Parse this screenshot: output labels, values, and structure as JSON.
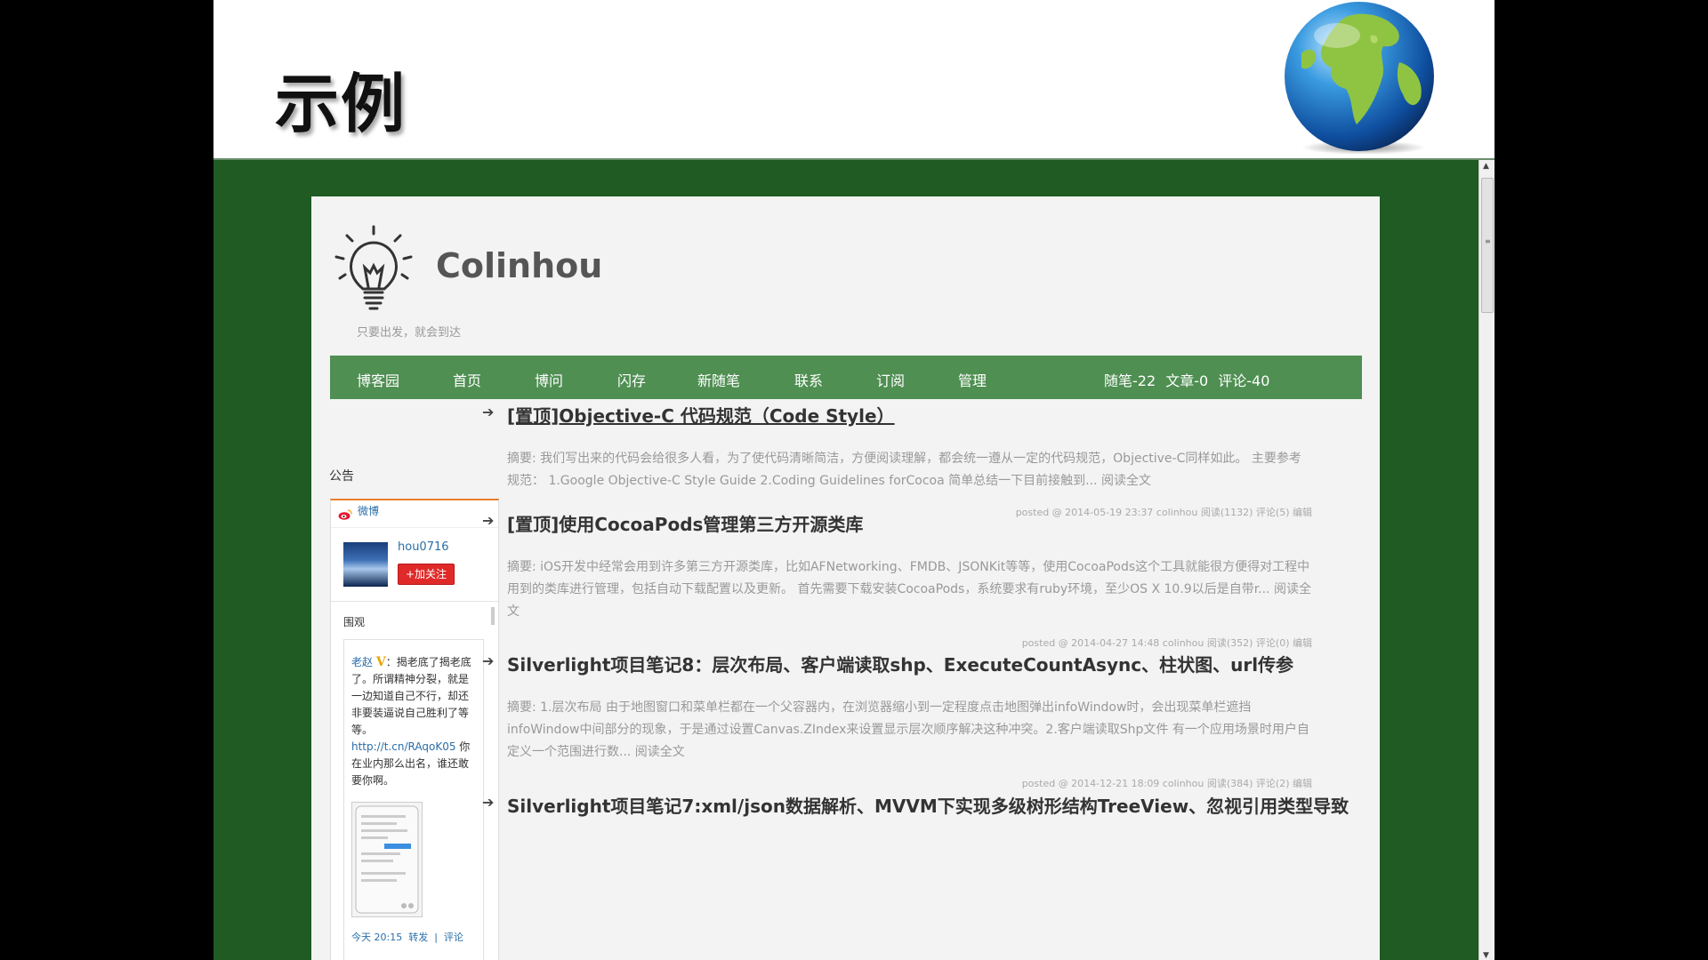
{
  "slide": {
    "title": "示例"
  },
  "blog": {
    "title": "Colinhou",
    "subtitle": "只要出发，就会到达"
  },
  "nav": {
    "items": [
      "博客园",
      "首页",
      "博问",
      "闪存",
      "新随笔",
      "联系",
      "订阅",
      "管理"
    ],
    "stats": "随笔-22  文章-0  评论-40"
  },
  "sidebar": {
    "notice_label": "公告",
    "weibo": {
      "label": "微博",
      "username": "hou0716",
      "follow_label": "+加关注",
      "feed_label": "围观",
      "post_user": "老赵",
      "post_text": "：揭老底了揭老底了。所谓精神分裂，就是一边知道自己不行，却还非要装逼说自己胜利了等等。",
      "post_link": "http://t.cn/RAqoK05",
      "post_text2": " 你在业内那么出名，谁还敢要你啊。",
      "footer_time": "今天 20:15",
      "footer_repost": "转发",
      "footer_comment": "评论"
    }
  },
  "posts": [
    {
      "title": "[置顶]Objective-C 代码规范（Code Style）",
      "summary": "摘要: 我们写出来的代码会给很多人看，为了使代码清晰简洁，方便阅读理解，都会统一遵从一定的代码规范，Objective-C同样如此。 主要参考规范： 1.Google Objective-C Style Guide 2.Coding Guidelines forCocoa 简单总结一下目前接触到... 阅读全文",
      "meta": "posted @ 2014-05-19 23:37 colinhou 阅读(1132) 评论(5) 编辑"
    },
    {
      "title": "[置顶]使用CocoaPods管理第三方开源类库",
      "summary": "摘要: iOS开发中经常会用到许多第三方开源类库，比如AFNetworking、FMDB、JSONKit等等，使用CocoaPods这个工具就能很方便得对工程中用到的类库进行管理，包括自动下载配置以及更新。 首先需要下载安装CocoaPods，系统要求有ruby环境，至少OS X 10.9以后是自带r... 阅读全文",
      "meta": "posted @ 2014-04-27 14:48 colinhou 阅读(352) 评论(0) 编辑"
    },
    {
      "title": "Silverlight项目笔记8：层次布局、客户端读取shp、ExecuteCountAsync、柱状图、url传参",
      "summary": "摘要: 1.层次布局 由于地图窗口和菜单栏都在一个父容器内，在浏览器缩小到一定程度点击地图弹出infoWindow时，会出现菜单栏遮挡infoWindow中间部分的现象，于是通过设置Canvas.ZIndex来设置显示层次顺序解决这种冲突。2.客户端读取Shp文件 有一个应用场景时用户自定义一个范围进行数... 阅读全文",
      "meta": "posted @ 2014-12-21 18:09 colinhou 阅读(384) 评论(2) 编辑"
    },
    {
      "title": "Silverlight项目笔记7:xml/json数据解析、MVVM下实现多级树形结构TreeView、忽视引用类型导致"
    }
  ]
}
